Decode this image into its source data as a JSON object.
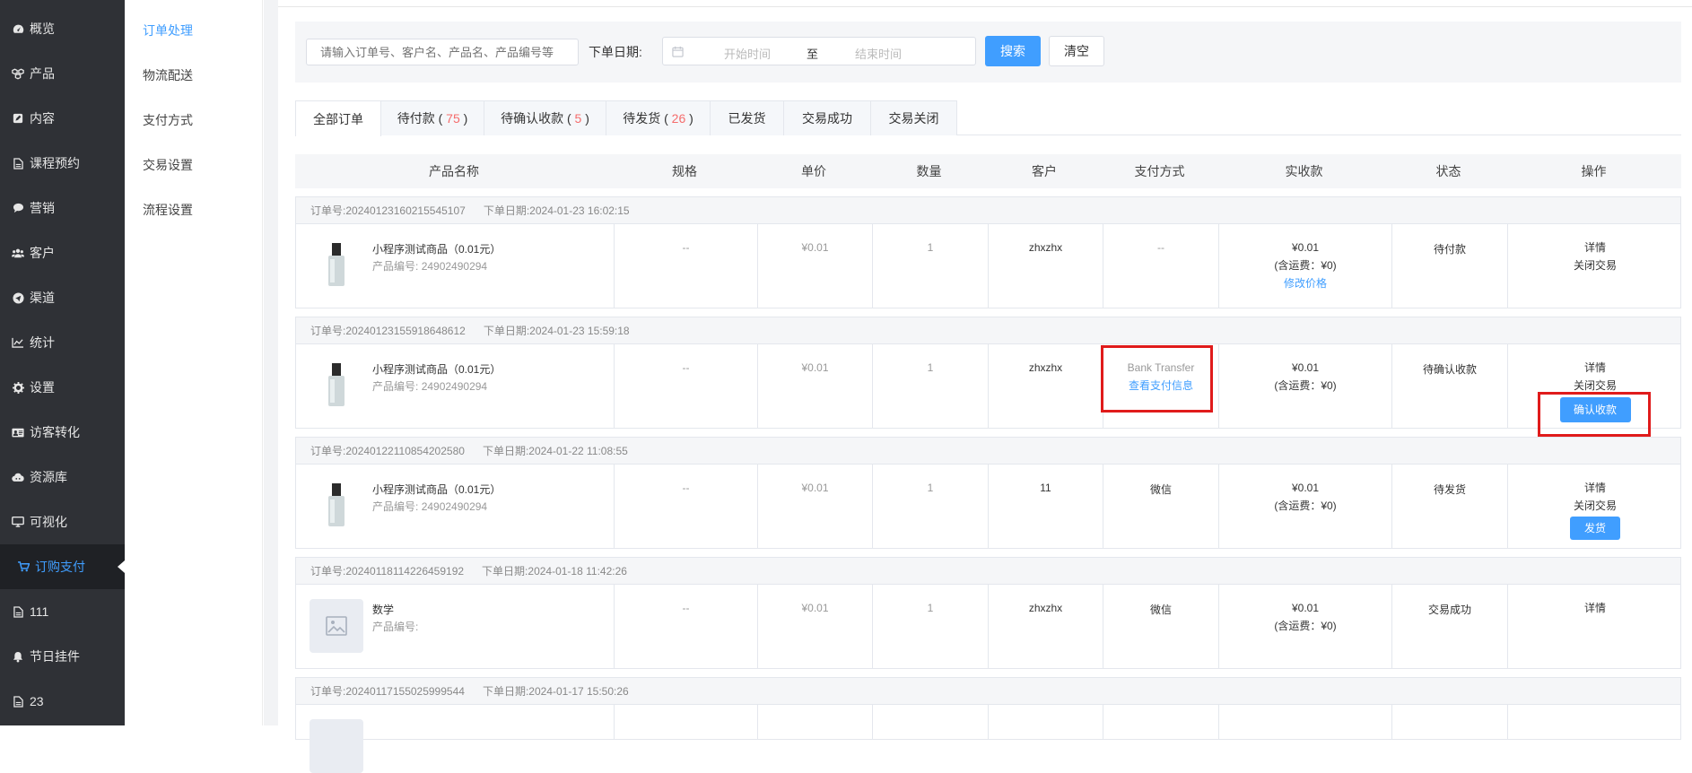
{
  "sidebar": {
    "items": [
      {
        "label": "概览",
        "icon": "dashboard-icon"
      },
      {
        "label": "产品",
        "icon": "cubes-icon"
      },
      {
        "label": "内容",
        "icon": "edit-icon"
      },
      {
        "label": "课程预约",
        "icon": "file-icon"
      },
      {
        "label": "营销",
        "icon": "chat-icon"
      },
      {
        "label": "客户",
        "icon": "users-icon"
      },
      {
        "label": "渠道",
        "icon": "send-icon"
      },
      {
        "label": "统计",
        "icon": "line-chart-icon"
      },
      {
        "label": "设置",
        "icon": "gear-icon"
      },
      {
        "label": "访客转化",
        "icon": "id-card-icon"
      },
      {
        "label": "资源库",
        "icon": "cloud-icon"
      },
      {
        "label": "可视化",
        "icon": "monitor-icon"
      },
      {
        "label": "订购支付",
        "icon": "cart-icon"
      },
      {
        "label": "111",
        "icon": "file-icon"
      },
      {
        "label": "节日挂件",
        "icon": "bell-icon"
      },
      {
        "label": "23",
        "icon": "file-icon"
      }
    ],
    "active_index": 12
  },
  "subnav": {
    "items": [
      "订单处理",
      "物流配送",
      "支付方式",
      "交易设置",
      "流程设置"
    ],
    "active_index": 0
  },
  "filter": {
    "search_placeholder": "请输入订单号、客户名、产品名、产品编号等",
    "date_label": "下单日期:",
    "start_placeholder": "开始时间",
    "separator": "至",
    "end_placeholder": "结束时间",
    "search_button": "搜索",
    "clear_button": "清空"
  },
  "tabs": [
    {
      "label": "全部订单",
      "count": null
    },
    {
      "label": "待付款",
      "count": "75"
    },
    {
      "label": "待确认收款",
      "count": "5"
    },
    {
      "label": "待发货",
      "count": "26"
    },
    {
      "label": "已发货",
      "count": null
    },
    {
      "label": "交易成功",
      "count": null
    },
    {
      "label": "交易关闭",
      "count": null
    }
  ],
  "table": {
    "headers": [
      "产品名称",
      "规格",
      "单价",
      "数量",
      "客户",
      "支付方式",
      "实收款",
      "状态",
      "操作"
    ],
    "order_no_label": "订单号:",
    "order_date_label": "下单日期:",
    "product_code_label": "产品编号:",
    "orders": [
      {
        "order_no": "20240123160215545107",
        "date": "2024-01-23 16:02:15",
        "product_name": "小程序测试商品（0.01元）",
        "product_code": "24902490294",
        "spec": "--",
        "price": "¥0.01",
        "qty": "1",
        "customer": "zhxzhx",
        "payment": "--",
        "amount": "¥0.01",
        "freight": "(含运费：¥0)",
        "price_link": "修改价格",
        "status": "待付款",
        "ops": [
          "详情",
          "关闭交易"
        ],
        "op_button": null
      },
      {
        "order_no": "20240123155918648612",
        "date": "2024-01-23 15:59:18",
        "product_name": "小程序测试商品（0.01元）",
        "product_code": "24902490294",
        "spec": "--",
        "price": "¥0.01",
        "qty": "1",
        "customer": "zhxzhx",
        "payment": "Bank Transfer",
        "payment_link": "查看支付信息",
        "amount": "¥0.01",
        "freight": "(含运费：¥0)",
        "status": "待确认收款",
        "ops": [
          "详情",
          "关闭交易"
        ],
        "op_button": "确认收款"
      },
      {
        "order_no": "20240122110854202580",
        "date": "2024-01-22 11:08:55",
        "product_name": "小程序测试商品（0.01元）",
        "product_code": "24902490294",
        "spec": "--",
        "price": "¥0.01",
        "qty": "1",
        "customer": "11",
        "payment": "微信",
        "amount": "¥0.01",
        "freight": "(含运费：¥0)",
        "status": "待发货",
        "ops": [
          "详情",
          "关闭交易"
        ],
        "op_button": "发货"
      },
      {
        "order_no": "20240118114226459192",
        "date": "2024-01-18 11:42:26",
        "product_name": "数学",
        "product_code": "",
        "spec": "--",
        "price": "¥0.01",
        "qty": "1",
        "customer": "zhxzhx",
        "payment": "微信",
        "amount": "¥0.01",
        "freight": "(含运费：¥0)",
        "status": "交易成功",
        "ops": [
          "详情"
        ],
        "op_button": null
      },
      {
        "order_no": "20240117155025999544",
        "date": "2024-01-17 15:50:26"
      }
    ]
  },
  "colors": {
    "sidebar_bg": "#2f3136",
    "accent": "#409eff",
    "highlight_box": "#e01b1b",
    "count_red": "#f56c6c"
  }
}
